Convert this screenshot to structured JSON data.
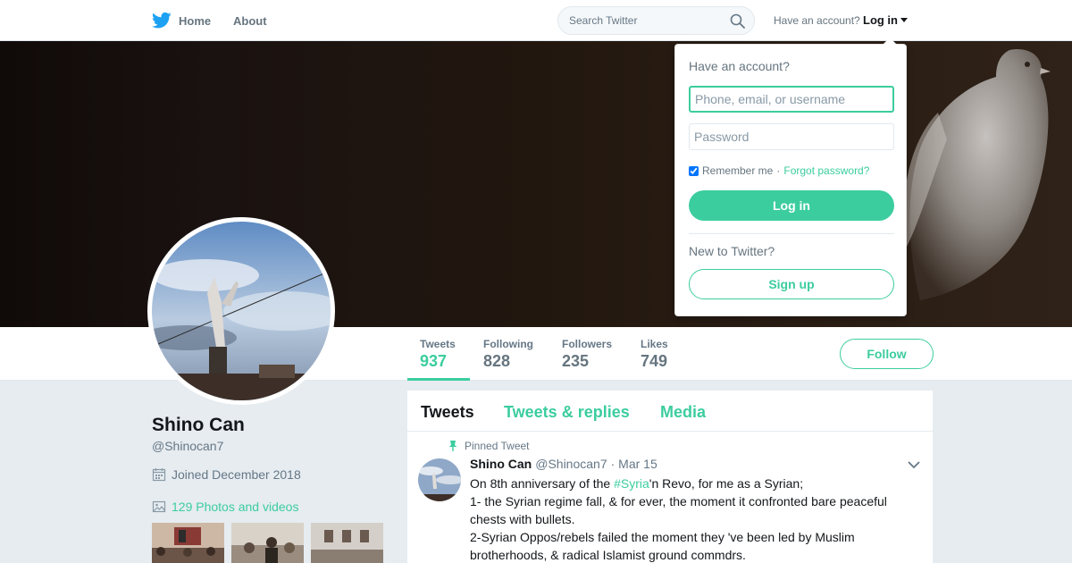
{
  "nav": {
    "home_label": "Home",
    "about_label": "About",
    "search_placeholder": "Search Twitter",
    "have_account": "Have an account?",
    "login_label": "Log in"
  },
  "profile": {
    "name": "Shino Can",
    "handle": "@Shinocan7",
    "joined": "Joined December 2018",
    "photos_label": "129 Photos and videos"
  },
  "stats": [
    {
      "label": "Tweets",
      "value": "937"
    },
    {
      "label": "Following",
      "value": "828"
    },
    {
      "label": "Followers",
      "value": "235"
    },
    {
      "label": "Likes",
      "value": "749"
    }
  ],
  "follow_label": "Follow",
  "timeline": {
    "tabs": [
      "Tweets",
      "Tweets & replies",
      "Media"
    ],
    "pinned_label": "Pinned Tweet",
    "tweet": {
      "name": "Shino Can",
      "handle": "@Shinocan7",
      "date": "· Mar 15",
      "line1_pre": "On 8th anniversary of the ",
      "hashtag": "#Syria",
      "line1_post": "'n Revo, for me as a Syrian;",
      "line2": "1- the Syrian regime fall, & for ever, the moment it confronted bare peaceful chests with bullets.",
      "line3": "2-Syrian Oppos/rebels failed the moment they 've been led by Muslim brotherhoods, & radical Islamist ground commdrs."
    }
  },
  "login_dropdown": {
    "title": "Have an account?",
    "username_placeholder": "Phone, email, or username",
    "password_placeholder": "Password",
    "remember_label": "Remember me",
    "separator": "·",
    "forgot_label": "Forgot password?",
    "login_button": "Log in",
    "new_label": "New to Twitter?",
    "signup_button": "Sign up"
  },
  "colors": {
    "accent": "#3ccd9e",
    "brand": "#1da1f2"
  },
  "icons": [
    "twitter-bird-icon",
    "search-icon",
    "caret-down-icon",
    "calendar-icon",
    "photo-icon",
    "pin-icon",
    "chevron-down-icon"
  ]
}
